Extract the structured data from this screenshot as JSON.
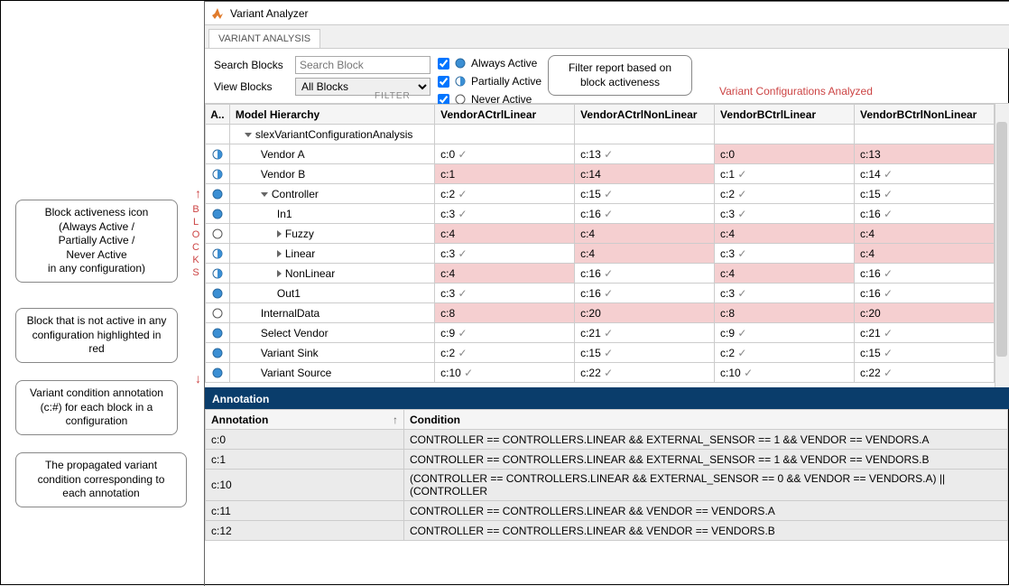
{
  "window": {
    "title": "Variant Analyzer"
  },
  "tab": {
    "label": "VARIANT ANALYSIS"
  },
  "filter": {
    "search_label": "Search Blocks",
    "search_placeholder": "Search Block",
    "view_label": "View Blocks",
    "view_value": "All Blocks",
    "always": "Always Active",
    "partially": "Partially Active",
    "never": "Never Active",
    "filter_word": "FILTER"
  },
  "config_label": "Variant Configurations Analyzed",
  "headers": {
    "a": "A..",
    "h": "Model Hierarchy",
    "c1": "VendorACtrlLinear",
    "c2": "VendorACtrlNonLinear",
    "c3": "VendorBCtrlLinear",
    "c4": "VendorBCtrlNonLinear"
  },
  "rows": [
    {
      "icon": "blank",
      "indent": 1,
      "arrow": "down",
      "name": "slexVariantConfigurationAnalysis",
      "c1": "",
      "c2": "",
      "c3": "",
      "c4": "",
      "p": [
        false,
        false,
        false,
        false
      ]
    },
    {
      "icon": "partial",
      "indent": 2,
      "arrow": "",
      "name": "Vendor A",
      "c1": "c:0",
      "c2": "c:13",
      "c3": "c:0",
      "c4": "c:13",
      "p": [
        false,
        false,
        true,
        true
      ],
      "chk": [
        true,
        true,
        false,
        false
      ]
    },
    {
      "icon": "partial",
      "indent": 2,
      "arrow": "",
      "name": "Vendor B",
      "c1": "c:1",
      "c2": "c:14",
      "c3": "c:1",
      "c4": "c:14",
      "p": [
        true,
        true,
        false,
        false
      ],
      "chk": [
        false,
        false,
        true,
        true
      ]
    },
    {
      "icon": "always",
      "indent": 2,
      "arrow": "down",
      "name": "Controller",
      "c1": "c:2",
      "c2": "c:15",
      "c3": "c:2",
      "c4": "c:15",
      "p": [
        false,
        false,
        false,
        false
      ],
      "chk": [
        true,
        true,
        true,
        true
      ]
    },
    {
      "icon": "always",
      "indent": 3,
      "arrow": "",
      "name": "In1",
      "c1": "c:3",
      "c2": "c:16",
      "c3": "c:3",
      "c4": "c:16",
      "p": [
        false,
        false,
        false,
        false
      ],
      "chk": [
        true,
        true,
        true,
        true
      ]
    },
    {
      "icon": "never",
      "indent": 3,
      "arrow": "right",
      "name": "Fuzzy",
      "c1": "c:4",
      "c2": "c:4",
      "c3": "c:4",
      "c4": "c:4",
      "p": [
        true,
        true,
        true,
        true
      ],
      "chk": [
        false,
        false,
        false,
        false
      ]
    },
    {
      "icon": "partial",
      "indent": 3,
      "arrow": "right",
      "name": "Linear",
      "c1": "c:3",
      "c2": "c:4",
      "c3": "c:3",
      "c4": "c:4",
      "p": [
        false,
        true,
        false,
        true
      ],
      "chk": [
        true,
        false,
        true,
        false
      ]
    },
    {
      "icon": "partial",
      "indent": 3,
      "arrow": "right",
      "name": "NonLinear",
      "c1": "c:4",
      "c2": "c:16",
      "c3": "c:4",
      "c4": "c:16",
      "p": [
        true,
        false,
        true,
        false
      ],
      "chk": [
        false,
        true,
        false,
        true
      ]
    },
    {
      "icon": "always",
      "indent": 3,
      "arrow": "",
      "name": "Out1",
      "c1": "c:3",
      "c2": "c:16",
      "c3": "c:3",
      "c4": "c:16",
      "p": [
        false,
        false,
        false,
        false
      ],
      "chk": [
        true,
        true,
        true,
        true
      ]
    },
    {
      "icon": "never",
      "indent": 2,
      "arrow": "",
      "name": "InternalData",
      "c1": "c:8",
      "c2": "c:20",
      "c3": "c:8",
      "c4": "c:20",
      "p": [
        true,
        true,
        true,
        true
      ],
      "chk": [
        false,
        false,
        false,
        false
      ]
    },
    {
      "icon": "always",
      "indent": 2,
      "arrow": "",
      "name": "Select Vendor",
      "c1": "c:9",
      "c2": "c:21",
      "c3": "c:9",
      "c4": "c:21",
      "p": [
        false,
        false,
        false,
        false
      ],
      "chk": [
        true,
        true,
        true,
        true
      ]
    },
    {
      "icon": "always",
      "indent": 2,
      "arrow": "",
      "name": "Variant Sink",
      "c1": "c:2",
      "c2": "c:15",
      "c3": "c:2",
      "c4": "c:15",
      "p": [
        false,
        false,
        false,
        false
      ],
      "chk": [
        true,
        true,
        true,
        true
      ]
    },
    {
      "icon": "always",
      "indent": 2,
      "arrow": "",
      "name": "Variant Source",
      "c1": "c:10",
      "c2": "c:22",
      "c3": "c:10",
      "c4": "c:22",
      "p": [
        false,
        false,
        false,
        false
      ],
      "chk": [
        true,
        true,
        true,
        true
      ]
    }
  ],
  "anno": {
    "title": "Annotation",
    "h1": "Annotation",
    "h2": "Condition",
    "rows": [
      {
        "a": "c:0",
        "c": "CONTROLLER == CONTROLLERS.LINEAR && EXTERNAL_SENSOR == 1 && VENDOR == VENDORS.A"
      },
      {
        "a": "c:1",
        "c": "CONTROLLER == CONTROLLERS.LINEAR && EXTERNAL_SENSOR == 1 && VENDOR == VENDORS.B"
      },
      {
        "a": "c:10",
        "c": "(CONTROLLER == CONTROLLERS.LINEAR && EXTERNAL_SENSOR == 0 && VENDOR == VENDORS.A) || (CONTROLLER"
      },
      {
        "a": "c:11",
        "c": "CONTROLLER == CONTROLLERS.LINEAR && VENDOR == VENDORS.A"
      },
      {
        "a": "c:12",
        "c": "CONTROLLER == CONTROLLERS.LINEAR && VENDOR == VENDORS.B"
      }
    ]
  },
  "callouts": {
    "filter": "Filter report based on block activeness",
    "icon": "Block activeness icon\n(Always Active /\nPartially Active /\nNever Active\nin any configuration)",
    "red": "Block that is not active in any configuration highlighted in red",
    "cond": "Variant condition annotation (c:#) for each block in a configuration",
    "prop": "The propagated variant condition corresponding to each annotation",
    "blocks": "BLOCKS"
  }
}
